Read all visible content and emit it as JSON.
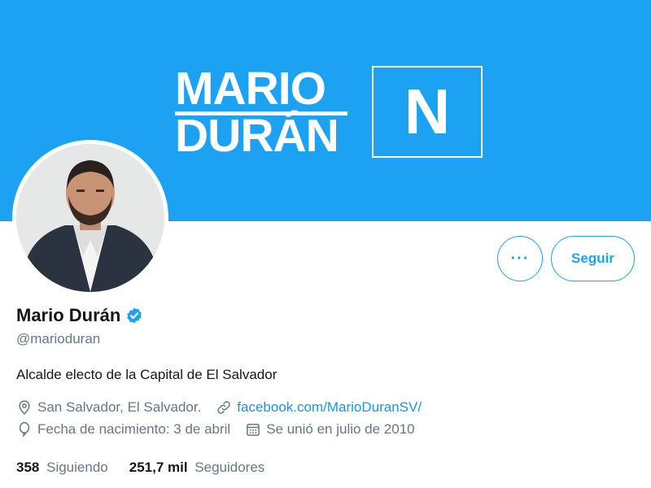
{
  "banner": {
    "logo_line1": "MARIO",
    "logo_line2": "DURÁN",
    "logo_badge": "N",
    "color": "#1da1f2"
  },
  "avatar": {
    "alt": "Mario Durán"
  },
  "actions": {
    "more_label": "···",
    "follow_label": "Seguir"
  },
  "profile": {
    "name": "Mario Durán",
    "verified": true,
    "handle": "@marioduran",
    "bio": "Alcalde electo de la Capital de El Salvador",
    "location": "San Salvador, El Salvador.",
    "website": "facebook.com/MarioDuranSV/",
    "birthday": "Fecha de nacimiento: 3 de abril",
    "joined": "Se unió en julio de 2010"
  },
  "stats": {
    "following_count": "358",
    "following_label": "Siguiendo",
    "followers_count": "251,7 mil",
    "followers_label": "Seguidores"
  },
  "icons": {
    "location": "location-pin-icon",
    "link": "link-icon",
    "birthday": "balloon-icon",
    "joined": "calendar-icon",
    "verified": "verified-badge-icon"
  },
  "colors": {
    "accent": "#1da1f2",
    "link": "#1b95e0",
    "secondary_text": "#657786",
    "primary_text": "#14171a"
  }
}
